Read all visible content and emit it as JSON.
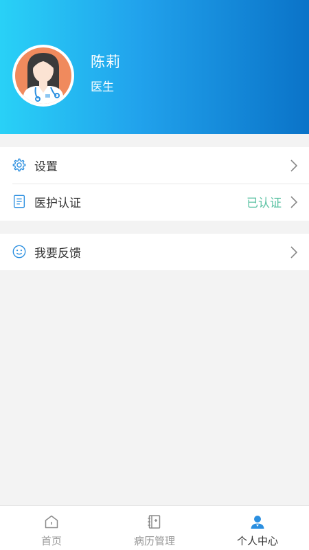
{
  "profile": {
    "name": "陈莉",
    "role": "医生",
    "avatar_icon": "doctor-avatar-icon"
  },
  "menu": {
    "settings": {
      "label": "设置",
      "icon": "gear-icon"
    },
    "certification": {
      "label": "医护认证",
      "status": "已认证",
      "icon": "document-icon"
    },
    "feedback": {
      "label": "我要反馈",
      "icon": "smiley-icon"
    }
  },
  "tabbar": {
    "tabs": [
      {
        "label": "首页",
        "icon": "home-icon",
        "active": false
      },
      {
        "label": "病历管理",
        "icon": "records-icon",
        "active": false
      },
      {
        "label": "个人中心",
        "icon": "person-icon",
        "active": true
      }
    ]
  },
  "colors": {
    "header_gradient_start": "#29d1f7",
    "header_gradient_end": "#0a73c8",
    "accent": "#2b8fe0",
    "status_green": "#5fc3a5"
  }
}
